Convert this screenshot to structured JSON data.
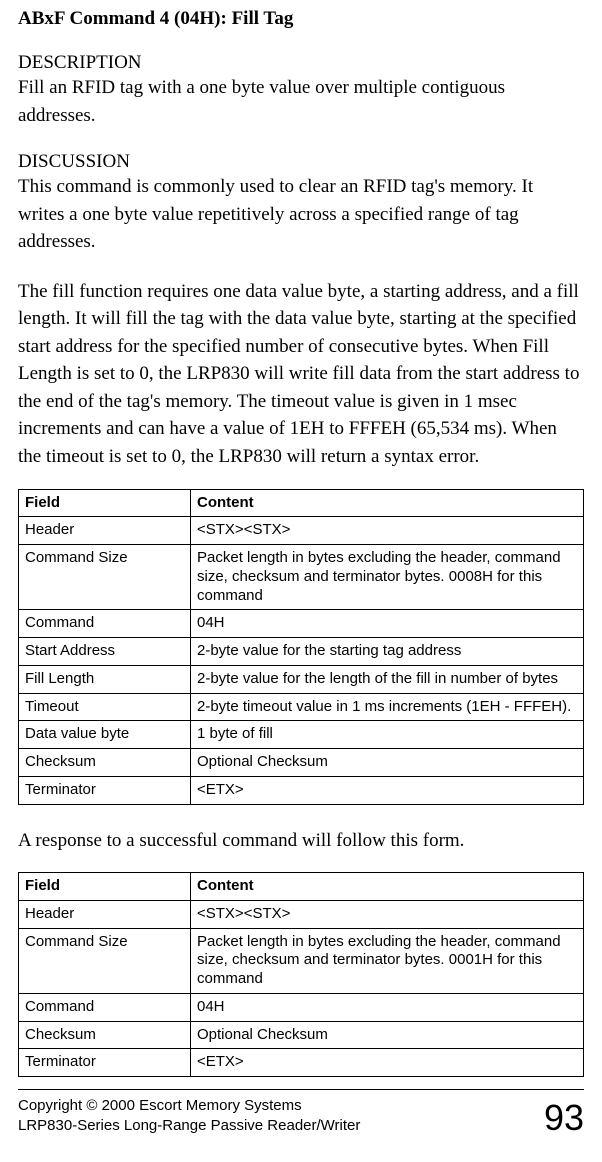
{
  "title": "ABxF Command 4 (04H): Fill Tag",
  "description_heading": "DESCRIPTION",
  "description_text": "Fill an RFID tag with a one byte value over multiple contiguous addresses.",
  "discussion_heading": "DISCUSSION",
  "discussion_text_1": "This command is commonly used to clear an RFID tag's memory. It writes a one byte value repetitively across a specified range of tag addresses.",
  "discussion_text_2": "The fill function requires one data value byte, a starting address, and a fill length. It will fill the tag with the data value byte, starting at the specified start address for the specified number of consecutive bytes. When Fill Length is set to 0, the LRP830 will write fill data from the start address to the end of the tag's memory. The timeout value is given in 1 msec increments and can have a value of 1EH to FFFEH (65,534 ms). When the timeout is set to 0, the LRP830 will return a syntax error.",
  "response_intro": "A response to a successful command will follow this form.",
  "table1": {
    "headers": {
      "field": "Field",
      "content": "Content"
    },
    "rows": [
      {
        "field": "Header",
        "content": "<STX><STX>"
      },
      {
        "field": "Command Size",
        "content": "Packet length in bytes excluding the header, command size, checksum and terminator bytes. 0008H for this command"
      },
      {
        "field": "Command",
        "content": "04H"
      },
      {
        "field": "Start Address",
        "content": "2-byte value for the starting tag address"
      },
      {
        "field": "Fill Length",
        "content": "2-byte value for the length of the fill in number of bytes"
      },
      {
        "field": "Timeout",
        "content": "2-byte timeout value in 1 ms increments (1EH - FFFEH)."
      },
      {
        "field": "Data value byte",
        "content": "1 byte of fill"
      },
      {
        "field": "Checksum",
        "content": "Optional Checksum"
      },
      {
        "field": "Terminator",
        "content": "<ETX>"
      }
    ]
  },
  "table2": {
    "headers": {
      "field": "Field",
      "content": "Content"
    },
    "rows": [
      {
        "field": "Header",
        "content": "<STX><STX>"
      },
      {
        "field": "Command Size",
        "content": "Packet length in bytes excluding the header, command size, checksum and terminator bytes. 0001H for this command"
      },
      {
        "field": "Command",
        "content": "04H"
      },
      {
        "field": "Checksum",
        "content": "Optional Checksum"
      },
      {
        "field": "Terminator",
        "content": "<ETX>"
      }
    ]
  },
  "footer": {
    "line1": "Copyright © 2000 Escort Memory Systems",
    "line2": "LRP830-Series Long-Range Passive Reader/Writer",
    "page": "93"
  }
}
